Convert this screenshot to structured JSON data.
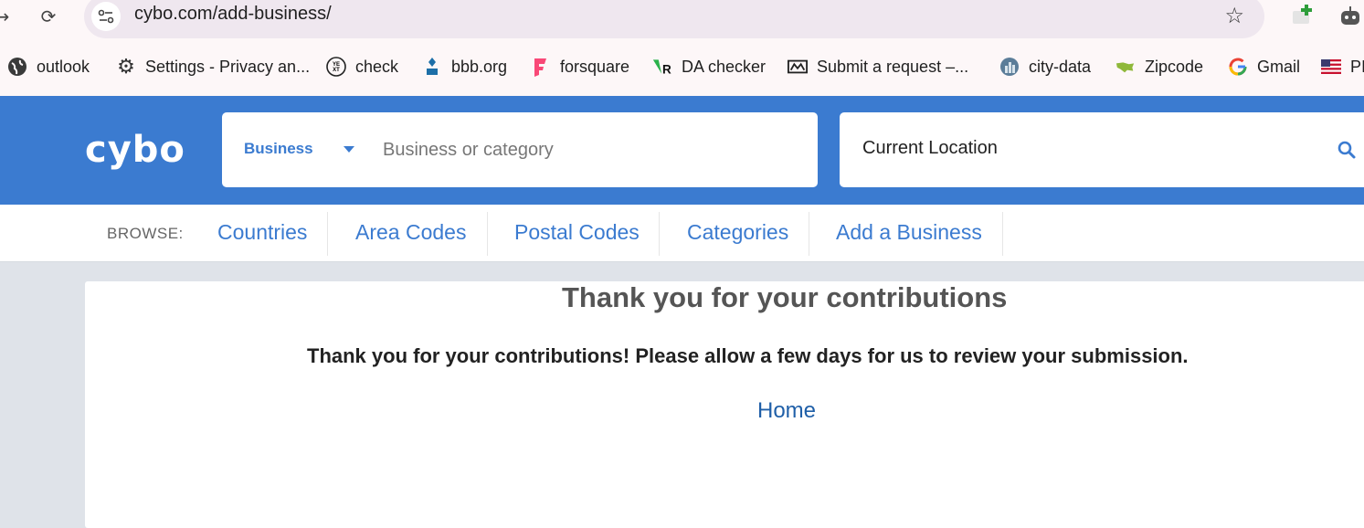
{
  "browser": {
    "url": "cybo.com/add-business/",
    "bookmarks": [
      {
        "label": "outlook",
        "icon": "globe-icon"
      },
      {
        "label": "Settings - Privacy an...",
        "icon": "gear-icon"
      },
      {
        "label": "check",
        "icon": "yext-icon"
      },
      {
        "label": "bbb.org",
        "icon": "bbb-icon"
      },
      {
        "label": "forsquare",
        "icon": "foursquare-icon"
      },
      {
        "label": "DA checker",
        "icon": "da-checker-icon"
      },
      {
        "label": "Submit a request –...",
        "icon": "zendesk-icon"
      },
      {
        "label": "city-data",
        "icon": "city-data-icon"
      },
      {
        "label": "Zipcode",
        "icon": "usa-map-icon"
      },
      {
        "label": "Gmail",
        "icon": "google-icon"
      },
      {
        "label": "PI",
        "icon": "us-flag-icon"
      }
    ]
  },
  "header": {
    "logo": "cybo",
    "search_type": "Business",
    "search_placeholder": "Business or category",
    "location": "Current Location"
  },
  "browse": {
    "label": "BROWSE:",
    "links": [
      "Countries",
      "Area Codes",
      "Postal Codes",
      "Categories",
      "Add a Business"
    ]
  },
  "content": {
    "title": "Thank you for your contributions",
    "message": "Thank you for your contributions! Please allow a few days for us to review your submission.",
    "home_link": "Home"
  },
  "colors": {
    "brand_blue": "#3b7bd0",
    "link_blue": "#1f5fa8",
    "page_bg": "#dfe3e9"
  }
}
